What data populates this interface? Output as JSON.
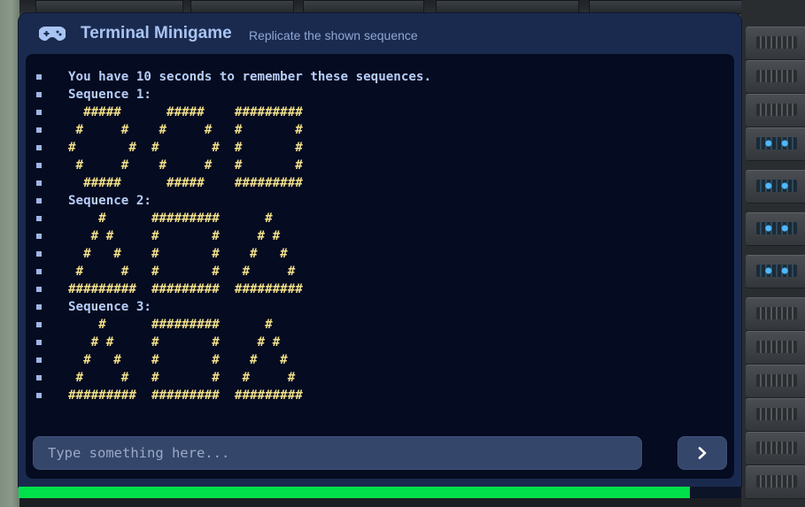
{
  "window": {
    "title": "Terminal Minigame",
    "subtitle": "Replicate the shown sequence",
    "header_icon": "gamepad-icon"
  },
  "terminal": {
    "lines": [
      {
        "kind": "prose",
        "text": "You have 10 seconds to remember these sequences."
      },
      {
        "kind": "prose",
        "text": "Sequence 1:"
      },
      {
        "kind": "art",
        "text": "  #####      #####    #########"
      },
      {
        "kind": "art",
        "text": " #     #    #     #   #       #"
      },
      {
        "kind": "art",
        "text": "#       #  #       #  #       #"
      },
      {
        "kind": "art",
        "text": " #     #    #     #   #       #"
      },
      {
        "kind": "art",
        "text": "  #####      #####    #########"
      },
      {
        "kind": "prose",
        "text": "Sequence 2:"
      },
      {
        "kind": "art",
        "text": "    #      #########      #"
      },
      {
        "kind": "art",
        "text": "   # #     #       #     # #"
      },
      {
        "kind": "art",
        "text": "  #   #    #       #    #   #"
      },
      {
        "kind": "art",
        "text": " #     #   #       #   #     #"
      },
      {
        "kind": "art",
        "text": "#########  #########  #########"
      },
      {
        "kind": "prose",
        "text": "Sequence 3:"
      },
      {
        "kind": "art",
        "text": "    #      #########      #"
      },
      {
        "kind": "art",
        "text": "   # #     #       #     # #"
      },
      {
        "kind": "art",
        "text": "  #   #    #       #    #   #"
      },
      {
        "kind": "art",
        "text": " #     #   #       #   #     #"
      },
      {
        "kind": "art",
        "text": "#########  #########  #########"
      }
    ]
  },
  "input": {
    "value": "",
    "placeholder": "Type something here...",
    "submit_icon": "chevron-right-icon"
  },
  "timer": {
    "remaining_fraction": 0.929,
    "color": "#00e04a"
  },
  "colors": {
    "window_bg": "#1a2a4e",
    "terminal_bg": "#050b20",
    "title": "#a9c4f2",
    "prose_text": "#b7cdf6",
    "art_text": "#f2e08a"
  }
}
